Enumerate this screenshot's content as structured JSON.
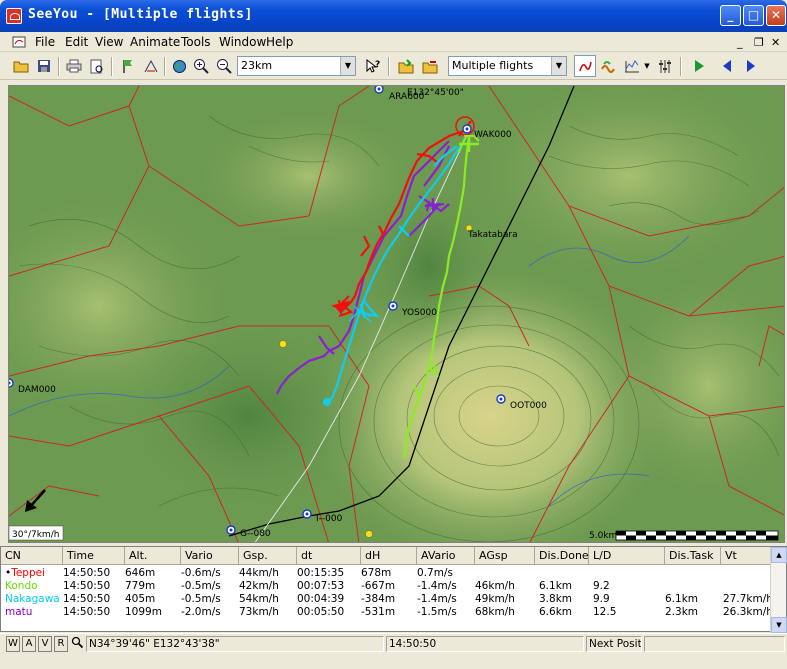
{
  "window": {
    "title": "SeeYou - [Multiple flights]"
  },
  "menu": [
    "File",
    "Edit",
    "View",
    "Animate",
    "Tools",
    "Window",
    "Help"
  ],
  "toolbar": {
    "zoom_value": "23km",
    "view_mode": "Multiple flights"
  },
  "map": {
    "coord_top": "E132°45'00\"",
    "waypoints": [
      {
        "name": "ARA600"
      },
      {
        "name": "WAK000"
      },
      {
        "name": "Takatabara"
      },
      {
        "name": "YOS000"
      },
      {
        "name": "DAM000"
      },
      {
        "name": "OOT000"
      },
      {
        "name": "G--080"
      },
      {
        "name": "I--000"
      }
    ],
    "wind": "30°/7km/h",
    "scale": "5.0km"
  },
  "table": {
    "headers": [
      "CN",
      "Time",
      "Alt.",
      "Vario",
      "Gsp.",
      "dt",
      "dH",
      "AVario",
      "AGsp",
      "Dis.Done",
      "L/D",
      "Dis.Task",
      "Vt"
    ],
    "rows": [
      {
        "cn": "Teppei",
        "color": "#ff0000",
        "marker": "•",
        "time": "14:50:50",
        "alt": "646m",
        "vario": "-0.6m/s",
        "gsp": "44km/h",
        "dt": "00:15:35",
        "dh": "678m",
        "avario": "0.7m/s",
        "agsp": "",
        "disdone": "",
        "ld": "",
        "distask": "",
        "vt": ""
      },
      {
        "cn": "Kondo",
        "color": "#66dd00",
        "marker": "",
        "time": "14:50:50",
        "alt": "779m",
        "vario": "-0.5m/s",
        "gsp": "42km/h",
        "dt": "00:07:53",
        "dh": "-667m",
        "avario": "-1.4m/s",
        "agsp": "46km/h",
        "disdone": "6.1km",
        "ld": "9.2",
        "distask": "",
        "vt": ""
      },
      {
        "cn": "Nakagawa",
        "color": "#00ccee",
        "marker": "",
        "time": "14:50:50",
        "alt": "405m",
        "vario": "-0.5m/s",
        "gsp": "54km/h",
        "dt": "00:04:39",
        "dh": "-384m",
        "avario": "-1.4m/s",
        "agsp": "49km/h",
        "disdone": "3.8km",
        "ld": "9.9",
        "distask": "6.1km",
        "vt": "27.7km/h"
      },
      {
        "cn": "matu",
        "color": "#8800cc",
        "marker": "",
        "time": "14:50:50",
        "alt": "1099m",
        "vario": "-2.0m/s",
        "gsp": "73km/h",
        "dt": "00:05:50",
        "dh": "-531m",
        "avario": "-1.5m/s",
        "agsp": "68km/h",
        "disdone": "6.6km",
        "ld": "12.5",
        "distask": "2.3km",
        "vt": "26.3km/h"
      }
    ]
  },
  "status": {
    "buttons": [
      "W",
      "A",
      "V",
      "R"
    ],
    "coords": "N34°39'46\" E132°43'38\"",
    "time": "14:50:50",
    "next": "Next Positi"
  },
  "colors": {
    "teppei": "#ff0000",
    "kondo": "#66dd00",
    "nakagawa": "#00ccee",
    "matu": "#8800cc"
  }
}
